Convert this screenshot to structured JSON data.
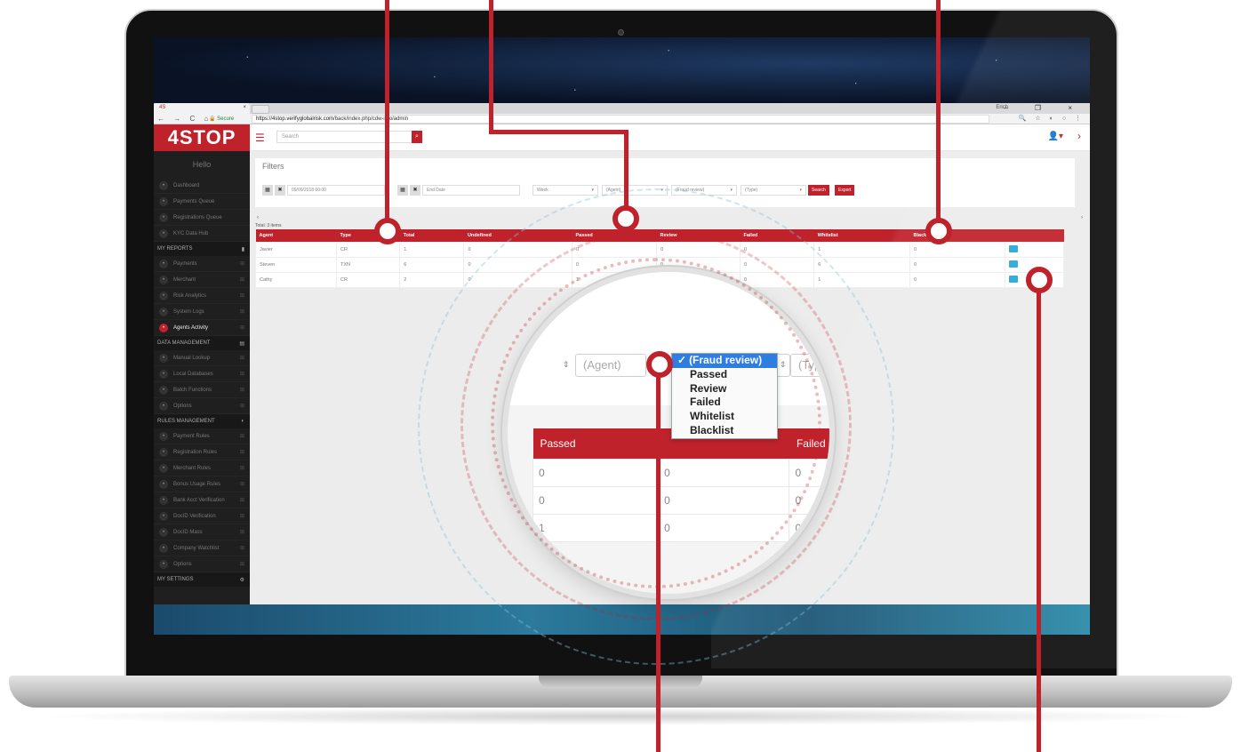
{
  "browser": {
    "tab_title": "4S",
    "tab_close": "×",
    "secure_label": "Secure",
    "url_host": "https://4stop.verifyglobalrisk.com",
    "url_path": "/back/index.php/cdw-info/admin",
    "nav_buttons": "← → C ⌂",
    "window_controls": "– ❐ ×",
    "window_user": "Erich",
    "toolbar_icons": "🔍 ☆ ◐ ○ ⋮"
  },
  "app": {
    "logo": "4STOP",
    "search_placeholder": "Search",
    "hello": "Hello"
  },
  "sidebar": {
    "items_top": [
      {
        "label": "Dashboard",
        "icon": "home-icon"
      },
      {
        "label": "Payments Queue",
        "icon": "dollar-icon"
      },
      {
        "label": "Registrations Queue",
        "icon": "users-icon"
      },
      {
        "label": "KYC Data Hub",
        "icon": "hub-icon"
      }
    ],
    "section_reports": "MY REPORTS",
    "items_reports": [
      {
        "label": "Payments",
        "icon": "dollar-icon"
      },
      {
        "label": "Merchant",
        "icon": "merchant-icon"
      },
      {
        "label": "Risk Analytics",
        "icon": "chart-icon"
      },
      {
        "label": "System Logs",
        "icon": "log-icon"
      },
      {
        "label": "Agents Activity",
        "icon": "agents-icon",
        "active": true
      }
    ],
    "section_data": "DATA MANAGEMENT",
    "items_data": [
      {
        "label": "Manual Lookup",
        "icon": "search-icon"
      },
      {
        "label": "Local Databases",
        "icon": "database-icon"
      },
      {
        "label": "Batch Functions",
        "icon": "batch-icon"
      },
      {
        "label": "Options",
        "icon": "options-icon"
      }
    ],
    "section_rules": "RULES MANAGEMENT",
    "items_rules": [
      {
        "label": "Payment Rules",
        "icon": "dollar-icon"
      },
      {
        "label": "Registration Rules",
        "icon": "user-icon"
      },
      {
        "label": "Merchant Rules",
        "icon": "merchant-icon"
      },
      {
        "label": "Bonus Usage Rules",
        "icon": "bonus-icon"
      },
      {
        "label": "Bank Acct Verification",
        "icon": "bank-icon"
      },
      {
        "label": "DocID Verification",
        "icon": "doc-icon"
      },
      {
        "label": "DocID Mass",
        "icon": "doc-icon"
      },
      {
        "label": "Company Watchlist",
        "icon": "watchlist-icon"
      },
      {
        "label": "Options",
        "icon": "options-icon"
      }
    ],
    "section_settings": "MY SETTINGS"
  },
  "filters": {
    "title": "Filters",
    "start_date": "09/09/2018 00:00",
    "end_date_placeholder": "End Date",
    "period": "Week",
    "agent": "(Agent)",
    "fraud_review": "(Fraud review)",
    "type": "(Type)",
    "search_label": "Search",
    "export_label": "Export"
  },
  "table": {
    "total": "Total: 3 items",
    "headers": [
      "Agent",
      "Type",
      "Total",
      "Undefined",
      "Passed",
      "Review",
      "Failed",
      "Whitelist",
      "Blacklist",
      ""
    ],
    "rows": [
      [
        "Javier",
        "CR",
        "1",
        "0",
        "0",
        "0",
        "0",
        "1",
        "0"
      ],
      [
        "Steven",
        "TXN",
        "6",
        "0",
        "0",
        "0",
        "0",
        "6",
        "0"
      ],
      [
        "Cathy",
        "CR",
        "2",
        "0",
        "1",
        "0",
        "0",
        "1",
        "0"
      ]
    ]
  },
  "zoom": {
    "agent": "(Agent)",
    "type": "(Type)",
    "headers": [
      "Passed",
      "",
      "Failed"
    ],
    "rows": [
      [
        "0",
        "0",
        "0"
      ],
      [
        "0",
        "0",
        "0"
      ],
      [
        "1",
        "0",
        "0"
      ]
    ],
    "dropdown_options": [
      "(Fraud review)",
      "Passed",
      "Review",
      "Failed",
      "Whitelist",
      "Blacklist"
    ],
    "selected_index": 0,
    "check": "✓"
  },
  "colors": {
    "brand_red": "#c0222c",
    "selected_blue": "#2f7de1",
    "action_blue": "#29a8d8"
  }
}
